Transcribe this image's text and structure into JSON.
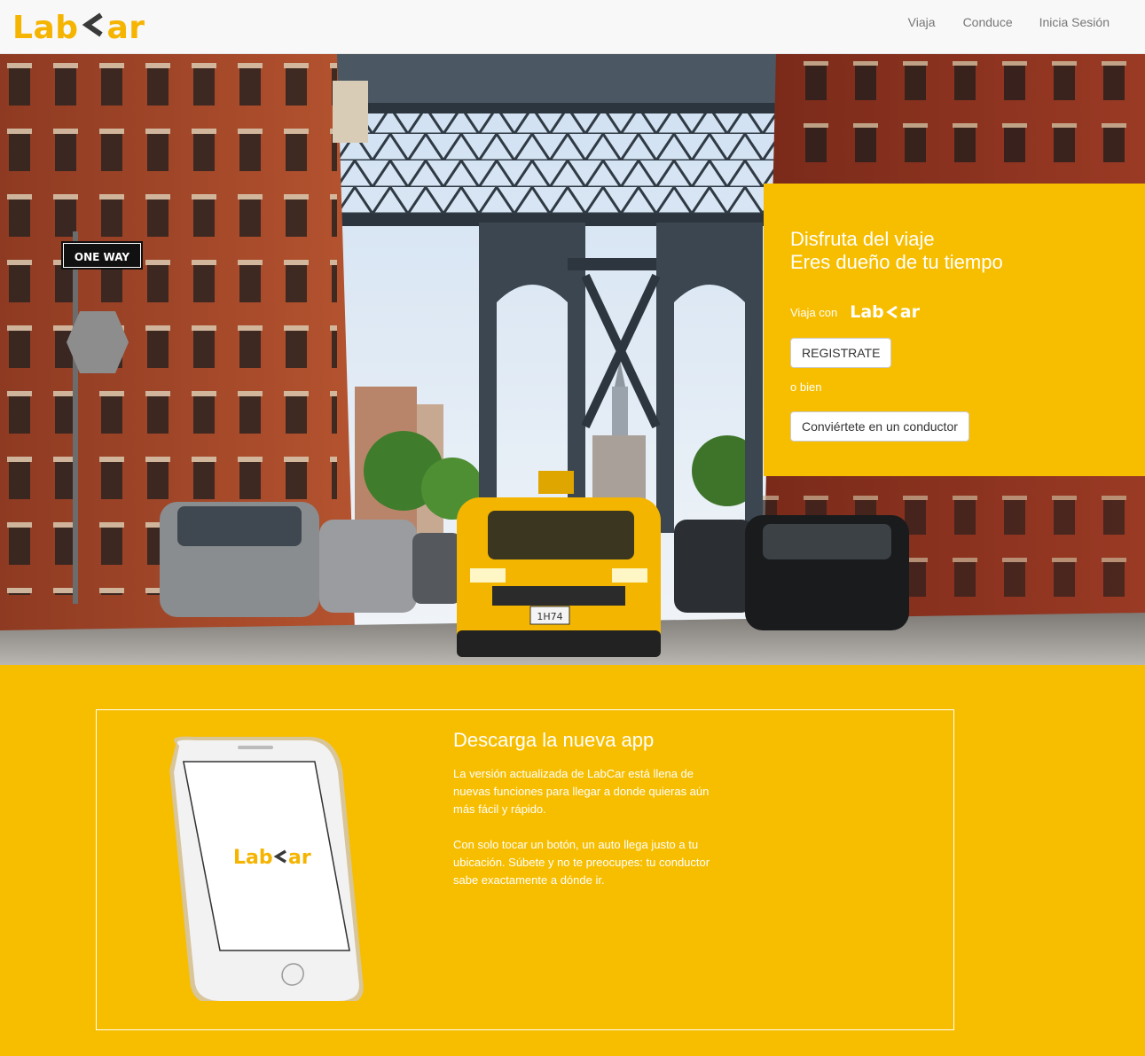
{
  "nav": {
    "brand": {
      "left": "Lab",
      "right": "ar"
    },
    "links": [
      "Viaja",
      "Conduce",
      "Inicia Sesión"
    ]
  },
  "hero": {
    "title_line1": "Disfruta del viaje",
    "title_line2": "Eres dueño de tu tiempo",
    "ride_with": "Viaja con",
    "mini_logo": {
      "left": "Lab",
      "right": "ar"
    },
    "register_button": "REGISTRATE",
    "or_text": "o bien",
    "driver_button": "Conviértete en un conductor",
    "street_sign": "ONE WAY",
    "taxi_plate": "1H74"
  },
  "app_section": {
    "title": "Descarga la nueva app",
    "paragraph1": "La versión actualizada de LabCar está llena de nuevas funciones para llegar a donde quieras aún más fácil y rápido.",
    "paragraph2": "Con solo tocar un botón, un auto llega justo a tu ubicación. Súbete y no te preocupes: tu conductor sabe exactamente a dónde ir.",
    "phone_logo": {
      "left": "Lab",
      "right": "ar"
    }
  },
  "colors": {
    "brand_yellow": "#f7be00",
    "nav_bg": "#f8f8f8",
    "nav_text": "#777777"
  }
}
